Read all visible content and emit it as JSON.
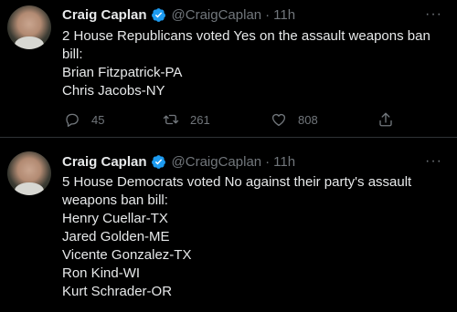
{
  "tweets": [
    {
      "author": {
        "name": "Craig Caplan",
        "handle": "@CraigCaplan",
        "verified_icon": "verified-badge-icon"
      },
      "time": "11h",
      "lines": [
        "2 House Republicans voted Yes on the assault weapons ban",
        "bill:",
        "Brian Fitzpatrick-PA",
        "Chris Jacobs-NY"
      ],
      "actions": {
        "replies": "45",
        "retweets": "261",
        "likes": "808"
      }
    },
    {
      "author": {
        "name": "Craig Caplan",
        "handle": "@CraigCaplan",
        "verified_icon": "verified-badge-icon"
      },
      "time": "11h",
      "lines": [
        "5 House Democrats voted No against their party's assault",
        "weapons ban bill:",
        "Henry Cuellar-TX",
        "Jared Golden-ME",
        "Vicente Gonzalez-TX",
        "Ron Kind-WI",
        "Kurt Schrader-OR"
      ]
    }
  ],
  "separator": "·",
  "more_glyph": "···",
  "colors": {
    "background": "#000000",
    "text": "#e7e9ea",
    "muted": "#71767b",
    "verified": "#1d9bf0"
  }
}
